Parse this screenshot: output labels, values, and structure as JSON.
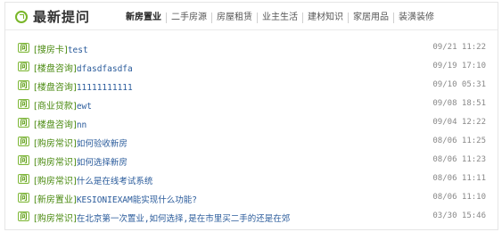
{
  "header": {
    "title": "最新提问",
    "tabs": [
      "新房置业",
      "二手房源",
      "房屋租赁",
      "业主生活",
      "建材知识",
      "家居用品",
      "装潢装修"
    ]
  },
  "questions": [
    {
      "category": "[搜房卡]",
      "text": "test",
      "date": "09/21 11:22"
    },
    {
      "category": "[楼盘咨询]",
      "text": "dfasdfasdfa",
      "date": "09/19 17:10"
    },
    {
      "category": "[楼盘咨询]",
      "text": "11111111111",
      "date": "09/10 05:31"
    },
    {
      "category": "[商业贷款]",
      "text": "ewt",
      "date": "09/08 18:51"
    },
    {
      "category": "[楼盘咨询]",
      "text": "nn",
      "date": "09/04 12:22"
    },
    {
      "category": "[购房常识]",
      "text": "如何验收新房",
      "date": "08/06 11:25"
    },
    {
      "category": "[购房常识]",
      "text": "如何选择新房",
      "date": "08/06 11:23"
    },
    {
      "category": "[购房常识]",
      "text": "什么是在线考试系统",
      "date": "08/06 11:11"
    },
    {
      "category": "[新房置业]",
      "text": "KESIONIEXAM能实现什么功能?",
      "date": "08/06 11:10"
    },
    {
      "category": "[购房常识]",
      "text": "在北京第一次置业,如何选择,是在市里买二手的还是在郊",
      "date": "03/30 15:46"
    }
  ]
}
